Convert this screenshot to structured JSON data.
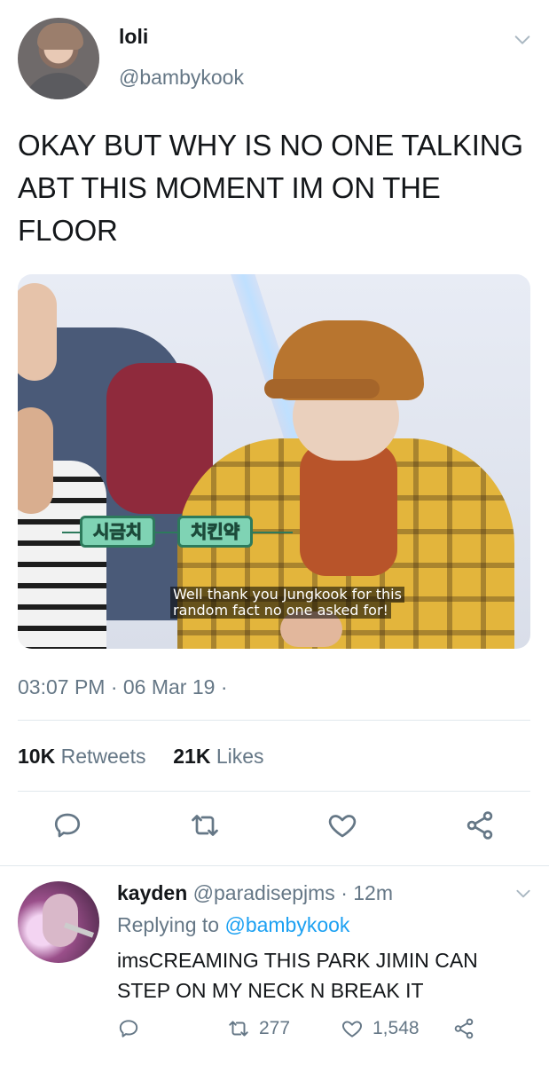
{
  "tweet": {
    "display_name": "loli",
    "handle": "@bambykook",
    "text": "OKAY BUT WHY IS NO ONE TALKING ABT THIS MOMENT IM ON THE FLOOR",
    "media": {
      "tag_left": "시금치",
      "tag_right": "치킨약",
      "subtitle_line1": "Well thank you Jungkook for this",
      "subtitle_line2": "random fact no one asked for!"
    },
    "timestamp": "03:07 PM · 06 Mar 19 ·",
    "retweets_count": "10K",
    "retweets_label": "Retweets",
    "likes_count": "21K",
    "likes_label": "Likes",
    "icons": {
      "reply": "reply-icon",
      "retweet": "retweet-icon",
      "like": "heart-icon",
      "share": "share-icon",
      "menu": "chevron-down-icon"
    }
  },
  "reply": {
    "display_name": "kayden",
    "handle": "@paradisepjms",
    "time_ago": "· 12m",
    "replying_prefix": "Replying to",
    "replying_to": "@bambykook",
    "text": "imsCREAMING THIS PARK JIMIN CAN STEP ON MY NECK N BREAK IT",
    "retweets": "277",
    "likes": "1,548"
  },
  "colors": {
    "text": "#14171a",
    "secondary": "#657786",
    "link": "#1da1f2",
    "divider": "#e1e8ed"
  }
}
